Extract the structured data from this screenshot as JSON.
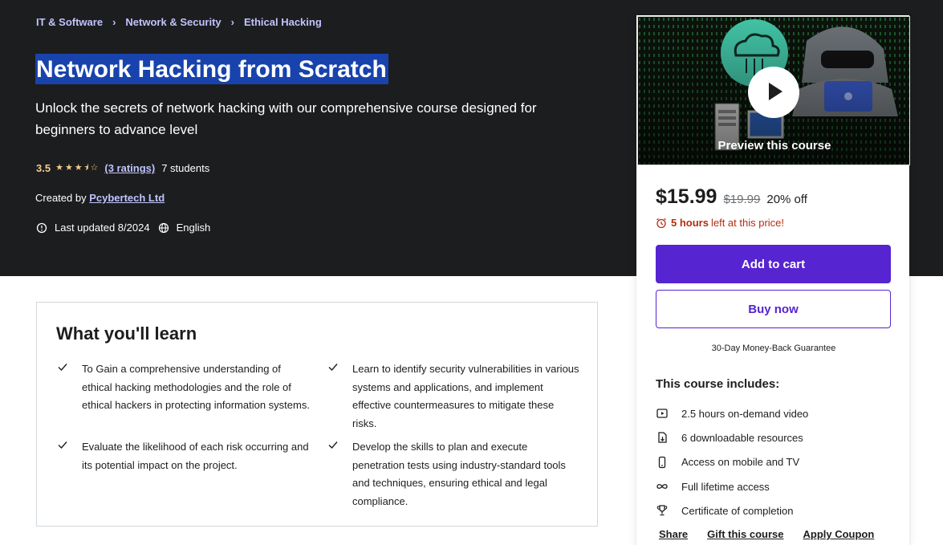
{
  "breadcrumb": [
    "IT & Software",
    "Network & Security",
    "Ethical Hacking"
  ],
  "course": {
    "title": "Network Hacking from Scratch",
    "subtitle": "Unlock the secrets of network hacking with our comprehensive course designed for beginners to advance level",
    "rating": "3.5",
    "rating_value": 3.5,
    "ratings_count": "(3 ratings)",
    "students": "7 students",
    "created_by_label": "Created by",
    "instructor": "Pcybertech Ltd",
    "last_updated": "Last updated 8/2024",
    "language": "English"
  },
  "card": {
    "preview_label": "Preview this course",
    "price": "$15.99",
    "original_price": "$19.99",
    "discount": "20% off",
    "timer_hours": "5 hours",
    "timer_suffix": "left at this price!",
    "add_to_cart": "Add to cart",
    "buy_now": "Buy now",
    "guarantee": "30-Day Money-Back Guarantee",
    "includes_title": "This course includes:",
    "includes": [
      "2.5 hours on-demand video",
      "6 downloadable resources",
      "Access on mobile and TV",
      "Full lifetime access",
      "Certificate of completion"
    ],
    "links": [
      "Share",
      "Gift this course",
      "Apply Coupon"
    ]
  },
  "learn": {
    "heading": "What you'll learn",
    "items": [
      "To Gain a comprehensive understanding of ethical hacking methodologies and the role of ethical hackers in protecting information systems.",
      "Learn to identify security vulnerabilities in various systems and applications, and implement effective countermeasures to mitigate these risks.",
      "Evaluate the likelihood of each risk occurring and its potential impact on the project.",
      "Develop the skills to plan and execute penetration tests using industry-standard tools and techniques, ensuring ethical and legal compliance."
    ]
  }
}
